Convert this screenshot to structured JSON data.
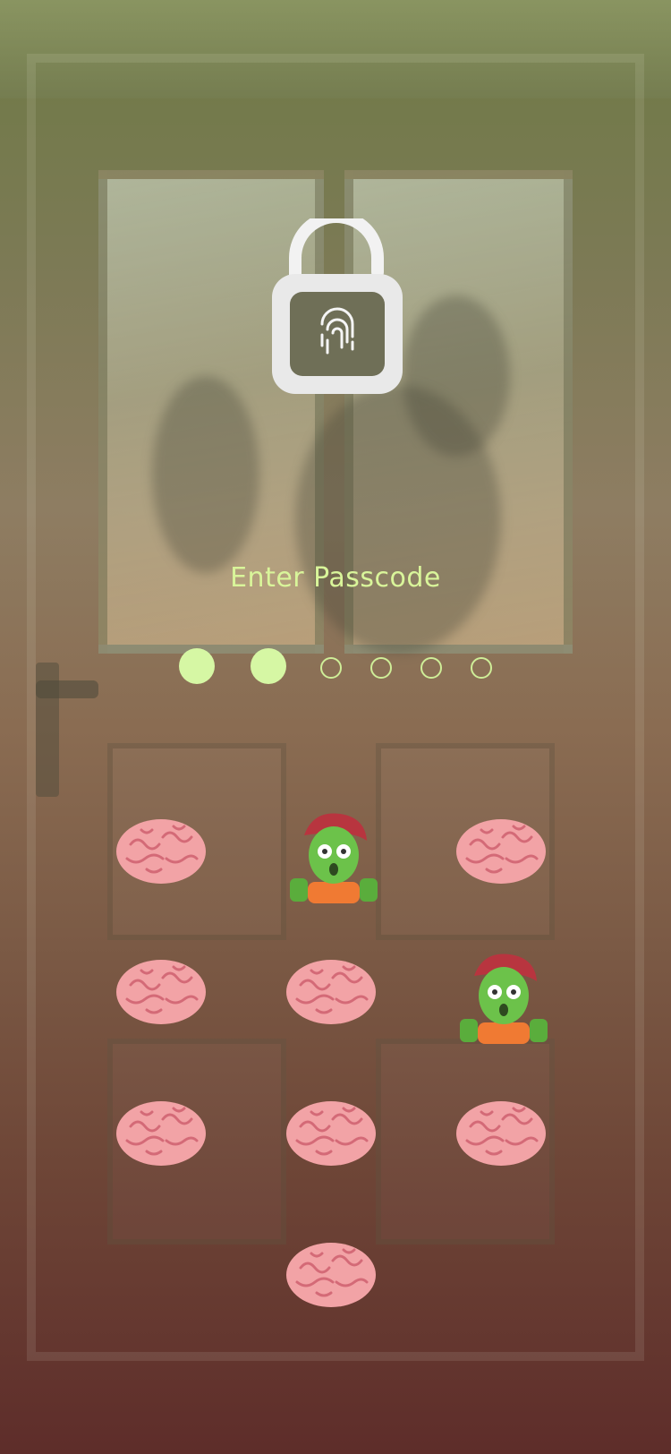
{
  "lockscreen": {
    "prompt": "Enter Passcode",
    "accent_color": "#d6f7a4",
    "lock_icon": "unlocked-padlock-fingerprint-icon",
    "passcode": {
      "length": 6,
      "entered": 2
    }
  },
  "keypad": {
    "rows": [
      [
        {
          "key": "1",
          "emoji": "brain"
        },
        {
          "key": "2",
          "emoji": "zombie"
        },
        {
          "key": "3",
          "emoji": "brain"
        }
      ],
      [
        {
          "key": "4",
          "emoji": "brain"
        },
        {
          "key": "5",
          "emoji": "brain"
        },
        {
          "key": "6",
          "emoji": "zombie"
        }
      ],
      [
        {
          "key": "7",
          "emoji": "brain"
        },
        {
          "key": "8",
          "emoji": "brain"
        },
        {
          "key": "9",
          "emoji": "brain"
        }
      ],
      [
        {
          "key": "0",
          "emoji": "brain"
        }
      ]
    ]
  }
}
